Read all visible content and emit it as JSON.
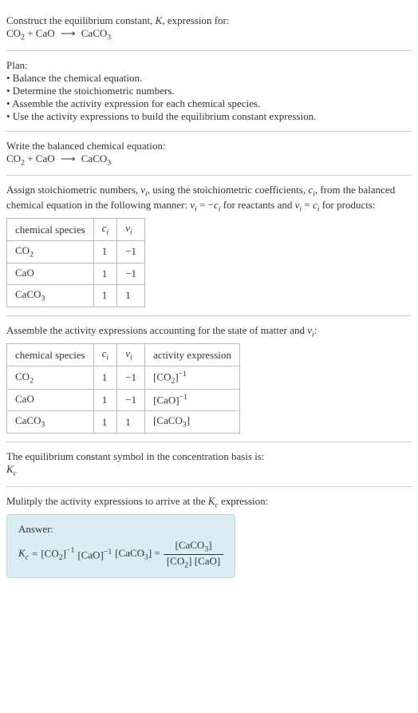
{
  "header": {
    "line1": "Construct the equilibrium constant, ",
    "k": "K",
    "line1b": ", expression for:",
    "eq_left_a": "CO",
    "eq_left_a_sub": "2",
    "plus": " + ",
    "eq_left_b": "CaO",
    "arrow": "⟶",
    "eq_right": "CaCO",
    "eq_right_sub": "3"
  },
  "plan": {
    "title": "Plan:",
    "b1": "• Balance the chemical equation.",
    "b2": "• Determine the stoichiometric numbers.",
    "b3": "• Assemble the activity expression for each chemical species.",
    "b4": "• Use the activity expressions to build the equilibrium constant expression."
  },
  "balanced": {
    "title": "Write the balanced chemical equation:"
  },
  "stoich": {
    "intro_a": "Assign stoichiometric numbers, ",
    "nu": "ν",
    "i": "i",
    "intro_b": ", using the stoichiometric coefficients, ",
    "c": "c",
    "intro_c": ", from the balanced chemical equation in the following manner: ",
    "eq1_lhs": "ν",
    "eq1_eq": " = −",
    "eq1_rhs": "c",
    "intro_d": " for reactants and ",
    "eq2": " = ",
    "intro_e": " for products:",
    "hdr_species": "chemical species",
    "hdr_c": "c",
    "hdr_nu": "ν",
    "rows": [
      {
        "sp_a": "CO",
        "sp_sub": "2",
        "c": "1",
        "nu": "−1"
      },
      {
        "sp_a": "CaO",
        "sp_sub": "",
        "c": "1",
        "nu": "−1"
      },
      {
        "sp_a": "CaCO",
        "sp_sub": "3",
        "c": "1",
        "nu": "1"
      }
    ]
  },
  "activity": {
    "title_a": "Assemble the activity expressions accounting for the state of matter and ",
    "title_b": ":",
    "hdr_act": "activity expression",
    "rows": [
      {
        "sp_a": "CO",
        "sp_sub": "2",
        "c": "1",
        "nu": "−1",
        "act_pre": "[CO",
        "act_sub": "2",
        "act_post": "]",
        "act_exp": "−1"
      },
      {
        "sp_a": "CaO",
        "sp_sub": "",
        "c": "1",
        "nu": "−1",
        "act_pre": "[CaO]",
        "act_sub": "",
        "act_post": "",
        "act_exp": "−1"
      },
      {
        "sp_a": "CaCO",
        "sp_sub": "3",
        "c": "1",
        "nu": "1",
        "act_pre": "[CaCO",
        "act_sub": "3",
        "act_post": "]",
        "act_exp": ""
      }
    ]
  },
  "symbol": {
    "line": "The equilibrium constant symbol in the concentration basis is:",
    "k": "K",
    "c": "c"
  },
  "multiply": {
    "line_a": "Mulitply the activity expressions to arrive at the ",
    "line_b": " expression:"
  },
  "answer": {
    "label": "Answer:",
    "k": "K",
    "c": "c",
    "eq": " = ",
    "t1": "[CO",
    "t1s": "2",
    "t1e": "]",
    "t1x": "−1",
    "t2": " [CaO]",
    "t2x": "−1",
    "t3": " [CaCO",
    "t3s": "3",
    "t3e": "] = ",
    "num": "[CaCO",
    "nums": "3",
    "nume": "]",
    "den1": "[CO",
    "den1s": "2",
    "den1e": "] ",
    "den2": "[CaO]"
  }
}
